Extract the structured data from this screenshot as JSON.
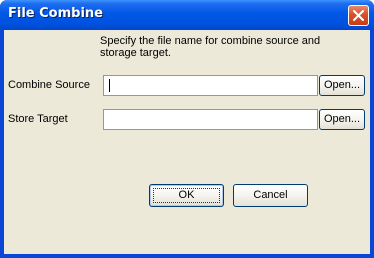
{
  "window": {
    "title": "File Combine"
  },
  "dialog": {
    "description_line1": "Specify the file name for combine source and",
    "description_line2": "storage target.",
    "combine_source": {
      "label": "Combine Source",
      "value": "",
      "open_label": "Open..."
    },
    "store_target": {
      "label": "Store Target",
      "value": "",
      "open_label": "Open..."
    },
    "ok_label": "OK",
    "cancel_label": "Cancel"
  },
  "icons": {
    "close": "close-icon"
  },
  "colors": {
    "titlebar": "#0058e6",
    "close_button": "#d8502c",
    "dialog_background": "#ece9d8",
    "input_border": "#7f9db9",
    "button_border": "#003c74"
  }
}
